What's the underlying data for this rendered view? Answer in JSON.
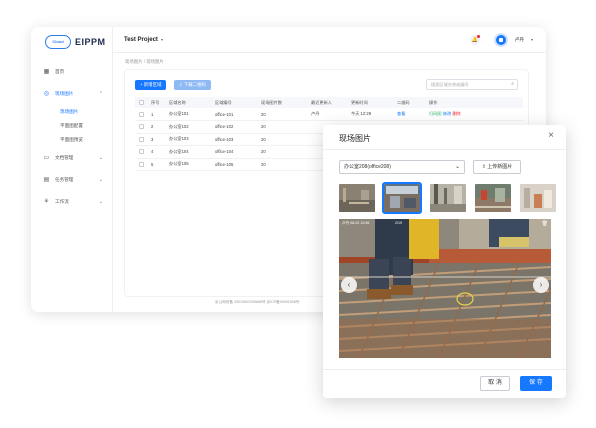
{
  "app": {
    "logo_badge": "Cloud",
    "logo_text": "EIPPM",
    "project": "Test Project",
    "user": "卢丹"
  },
  "sidebar": {
    "items": [
      {
        "label": "首页",
        "icon": "grid-icon"
      },
      {
        "label": "现场图片",
        "icon": "camera-icon",
        "active": true
      },
      {
        "label": "现场图片",
        "sub": true,
        "active": true
      },
      {
        "label": "平面图配置",
        "sub": true
      },
      {
        "label": "平面图预览",
        "sub": true
      },
      {
        "label": "文档管理",
        "icon": "folder-icon"
      },
      {
        "label": "任务管理",
        "icon": "task-icon"
      },
      {
        "label": "工作流",
        "icon": "workflow-icon"
      }
    ]
  },
  "breadcrumb": "现场图片 / 现场图片",
  "toolbar": {
    "add_label": "+ 新增区域",
    "download_label": "⇩ 下载二维码",
    "search_placeholder": "搜索区域名称或编号"
  },
  "table": {
    "headers": [
      "序号",
      "区域名称",
      "区域编号",
      "现场图片数",
      "最近更新人",
      "更新时间",
      "二维码",
      "操作"
    ],
    "rows": [
      {
        "no": "1",
        "name": "办公室101",
        "code": "office-101",
        "count": "20",
        "updater": "卢丹",
        "time": "今天 12:29",
        "qr": "查看",
        "ops": [
          "扫码图",
          "修改",
          "删除"
        ]
      },
      {
        "no": "2",
        "name": "办公室102",
        "code": "office-102",
        "count": "20",
        "updater": "",
        "time": "",
        "qr": "",
        "ops": []
      },
      {
        "no": "3",
        "name": "办公室103",
        "code": "office-103",
        "count": "20",
        "updater": "",
        "time": "",
        "qr": "",
        "ops": []
      },
      {
        "no": "4",
        "name": "办公室104",
        "code": "office-104",
        "count": "20",
        "updater": "",
        "time": "",
        "qr": "",
        "ops": []
      },
      {
        "no": "5",
        "name": "办公室105",
        "code": "office-105",
        "count": "20",
        "updater": "",
        "time": "",
        "qr": "",
        "ops": []
      }
    ]
  },
  "footer_note": "京公网安备 33010602009888号 京ICP备09091508号",
  "modal": {
    "title": "现场图片",
    "select_value": "办公室208(office208)",
    "upload_label": "上传新图片",
    "viewer_label": "卢丹 08-02 10:56",
    "viewer_label2": "2/19",
    "cancel_label": "取 消",
    "save_label": "保 存"
  },
  "colors": {
    "primary": "#1677ff",
    "success": "#2fb56a",
    "danger": "#f5222d"
  }
}
